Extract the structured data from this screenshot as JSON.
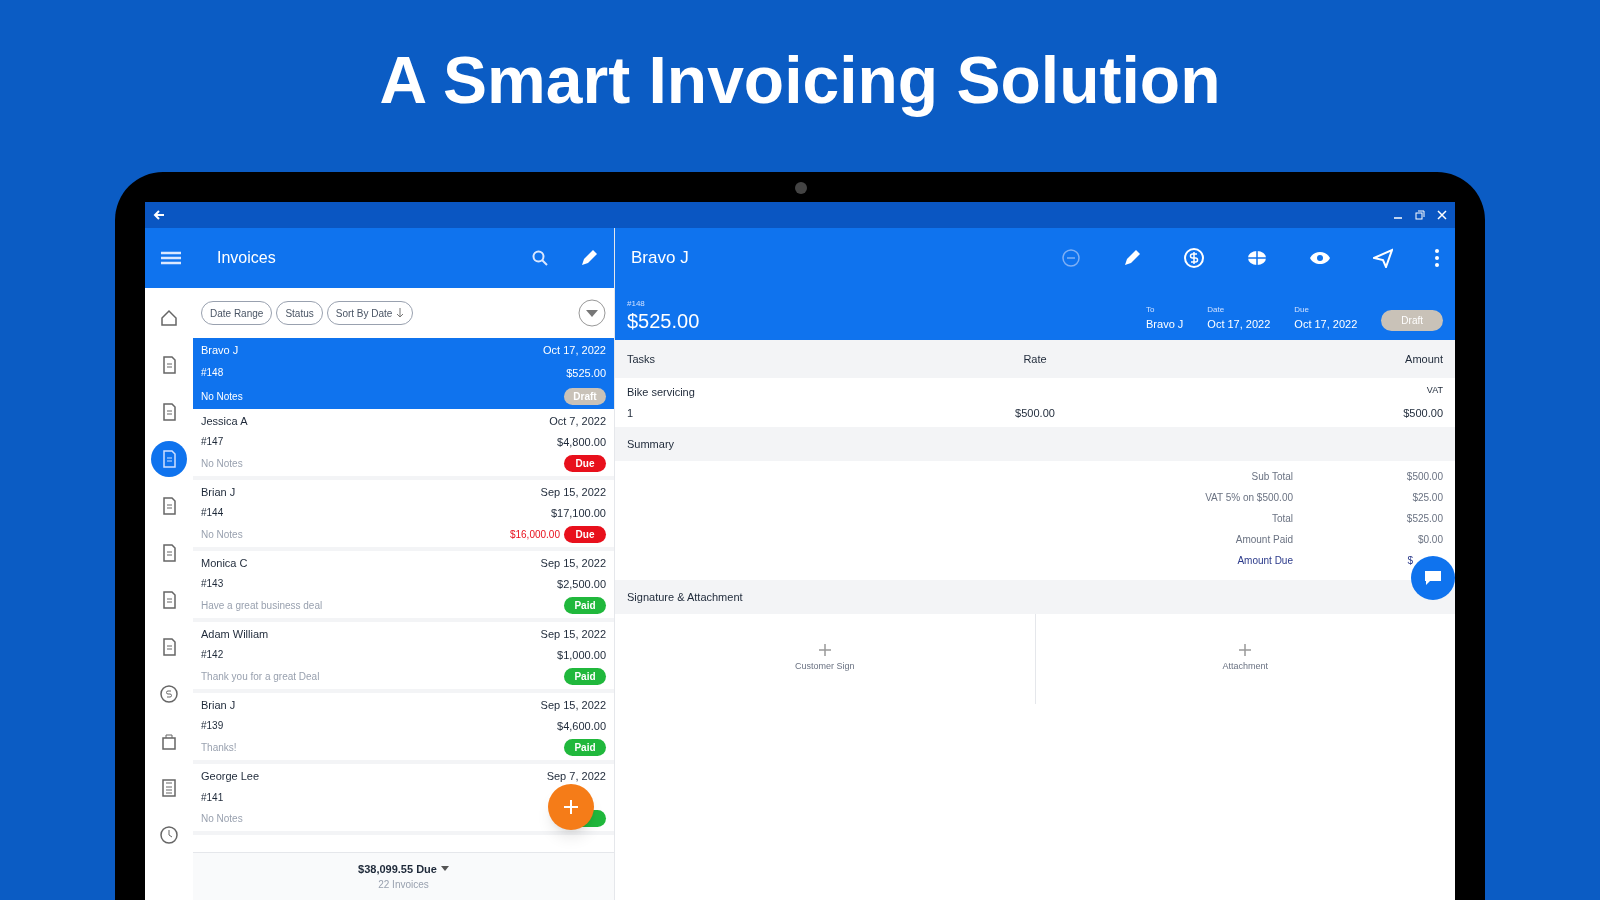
{
  "headline": "A Smart Invoicing Solution",
  "app_bar": {
    "title": "Invoices",
    "detail_title": "Bravo J"
  },
  "rail": [
    {
      "kind": "home",
      "selected": false
    },
    {
      "kind": "doc",
      "selected": false
    },
    {
      "kind": "doc",
      "selected": false
    },
    {
      "kind": "doc",
      "selected": true
    },
    {
      "kind": "doc",
      "selected": false
    },
    {
      "kind": "doc",
      "selected": false
    },
    {
      "kind": "doc",
      "selected": false
    },
    {
      "kind": "doc",
      "selected": false
    },
    {
      "kind": "dollar",
      "selected": false
    },
    {
      "kind": "bag",
      "selected": false
    },
    {
      "kind": "calc",
      "selected": false
    },
    {
      "kind": "clock",
      "selected": false
    }
  ],
  "filters": [
    "Date Range",
    "Status",
    "Sort By Date"
  ],
  "invoices": [
    {
      "name": "Bravo J",
      "number": "#148",
      "notes": "No Notes",
      "date": "Oct 17, 2022",
      "amount": "$525.00",
      "kind": "draft",
      "status_label": "Draft",
      "selected": true
    },
    {
      "name": "Jessica A",
      "number": "#147",
      "notes": "No Notes",
      "date": "Oct 7, 2022",
      "amount": "$4,800.00",
      "kind": "due",
      "status_label": "Due",
      "selected": false
    },
    {
      "name": "Brian J",
      "number": "#144",
      "notes": "No Notes",
      "date": "Sep 15, 2022",
      "amount": "$17,100.00",
      "due_amount": "$16,000.00",
      "kind": "due",
      "status_label": "Due",
      "selected": false
    },
    {
      "name": "Monica C",
      "number": "#143",
      "notes": "Have a great business deal",
      "date": "Sep 15, 2022",
      "amount": "$2,500.00",
      "kind": "paid",
      "status_label": "Paid",
      "selected": false
    },
    {
      "name": "Adam William",
      "number": "#142",
      "notes": "Thank you for a great Deal",
      "date": "Sep 15, 2022",
      "amount": "$1,000.00",
      "kind": "paid",
      "status_label": "Paid",
      "selected": false
    },
    {
      "name": "Brian J",
      "number": "#139",
      "notes": "Thanks!",
      "date": "Sep 15, 2022",
      "amount": "$4,600.00",
      "kind": "paid",
      "status_label": "Paid",
      "selected": false
    },
    {
      "name": "George Lee",
      "number": "#141",
      "notes": "No Notes",
      "date": "Sep 7, 2022",
      "kind": "paid",
      "selected": false
    }
  ],
  "list_footer": {
    "total": "$38,099.55 Due",
    "count": "22 Invoices"
  },
  "detail": {
    "number": "#148",
    "total": "$525.00",
    "to_label": "To",
    "to": "Bravo J",
    "date_label": "Date",
    "date": "Oct 17, 2022",
    "due_label": "Due",
    "due": "Oct 17, 2022",
    "status_label": "Draft",
    "columns": [
      "Tasks",
      "Rate",
      "Amount"
    ],
    "items": [
      {
        "task": "Bike servicing",
        "tax": "VAT",
        "qty": "1",
        "rate": "$500.00",
        "amount": "$500.00"
      }
    ],
    "summary_title": "Summary",
    "summary": [
      {
        "label": "Sub Total",
        "value": "$500.00",
        "strong": false
      },
      {
        "label": "VAT 5% on $500.00",
        "value": "$25.00",
        "strong": false
      },
      {
        "label": "Total",
        "value": "$525.00",
        "strong": false
      },
      {
        "label": "Amount Paid",
        "value": "$0.00",
        "strong": false
      },
      {
        "label": "Amount Due",
        "value": "$",
        "strong": true
      }
    ],
    "attach_title": "Signature & Attachment",
    "attach": [
      "Customer Sign",
      "Attachment"
    ]
  }
}
